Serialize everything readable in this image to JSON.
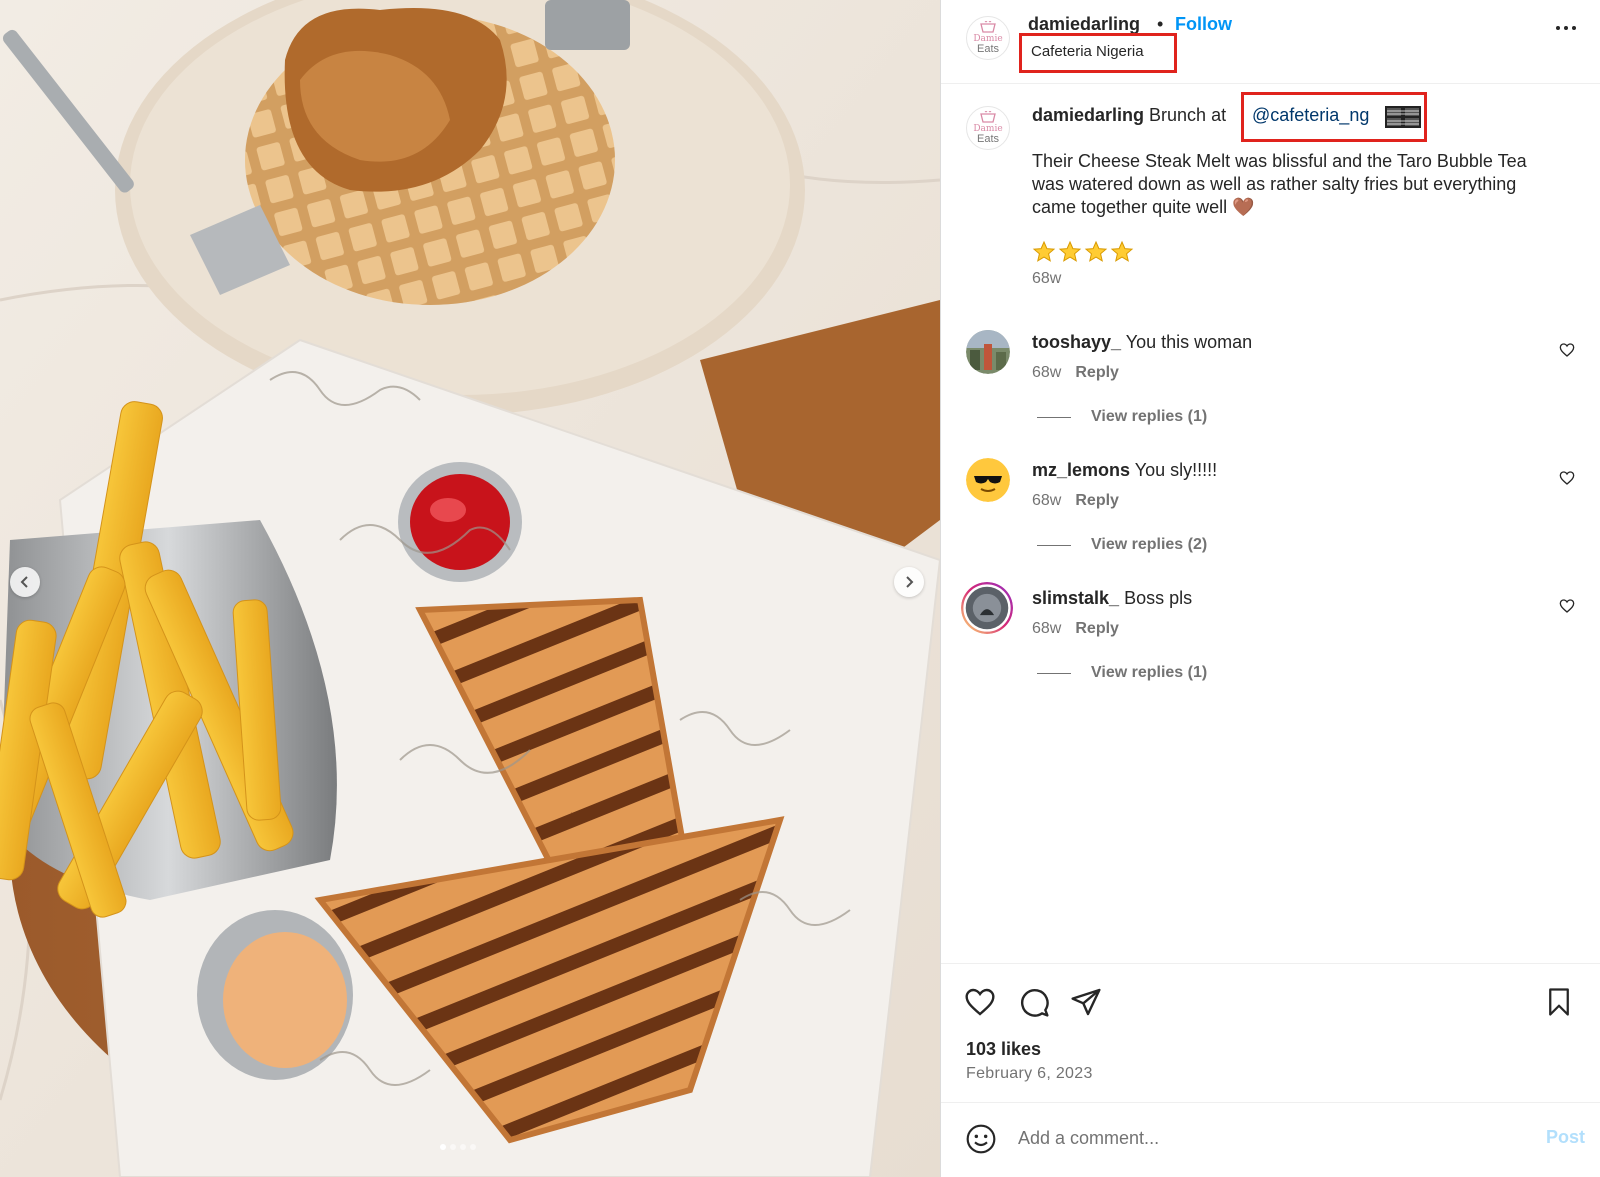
{
  "post": {
    "image_alt": "Photo of chicken and waffles, fries, ketchup and grilled cheese steak melt",
    "carousel": {
      "total_images": 4,
      "active_index": 0
    }
  },
  "header": {
    "avatar_text_top": "Damie",
    "avatar_text_bottom": "Eats",
    "username": "damiedarling",
    "separator": "•",
    "follow_label": "Follow",
    "location": "Cafeteria Nigeria",
    "more_icon": "more-horizontal-icon"
  },
  "caption": {
    "username": "damiedarling",
    "text_before_mention": " Brunch at",
    "mention": "@cafeteria_ng",
    "flag_icon": "nigeria-flag-icon",
    "body": "Their Cheese Steak Melt was blissful and the Taro Bubble Tea was watered down as well as rather salty fries but everything came together quite well 🤎",
    "stars": "⭐⭐⭐⭐",
    "rating_count": 4,
    "time": "68w"
  },
  "comments": [
    {
      "username": "tooshayy_",
      "text": "You this woman",
      "time": "68w",
      "reply_label": "Reply",
      "view_replies": "View replies (1)"
    },
    {
      "username": "mz_lemons",
      "text": "You sly!!!!!",
      "time": "68w",
      "reply_label": "Reply",
      "view_replies": "View replies (2)"
    },
    {
      "username": "slimstalk_",
      "text": "Boss pls",
      "time": "68w",
      "reply_label": "Reply",
      "view_replies": "View replies (1)"
    }
  ],
  "actions": {
    "likes": "103 likes",
    "date": "February 6, 2023"
  },
  "composer": {
    "placeholder": "Add a comment...",
    "post_label": "Post"
  },
  "colors": {
    "accent_blue": "#0095f6",
    "mention_blue": "#00376b",
    "highlight_red": "#e0231d",
    "post_disabled": "#b2dffc",
    "secondary_text": "#737373"
  }
}
